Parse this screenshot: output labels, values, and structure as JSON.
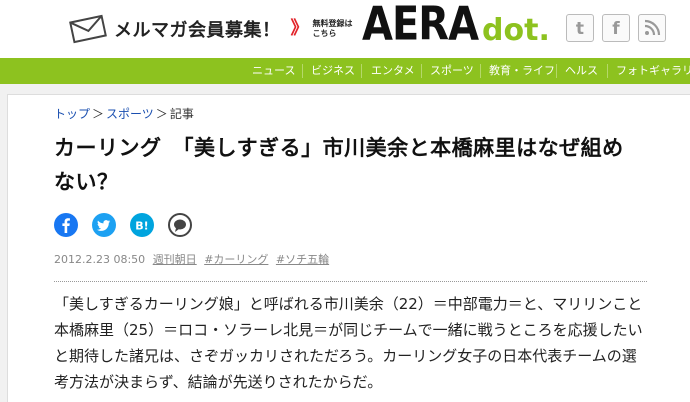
{
  "header": {
    "promo_text": "メルマガ会員募集！",
    "chevron": "》",
    "register_line1": "無料登録は",
    "register_line2": "こちら",
    "logo_aera": "AERA",
    "logo_dot": "dot."
  },
  "social_icons": [
    {
      "icon": "twitter-icon",
      "glyph": "t"
    },
    {
      "icon": "facebook-icon",
      "glyph": "f"
    },
    {
      "icon": "rss-icon",
      "glyph": "\\"
    }
  ],
  "nav": [
    "ニュース",
    "ビジネス",
    "エンタメ",
    "スポーツ",
    "教育・ライフ",
    "ヘルス",
    "フォトギャラリー"
  ],
  "breadcrumb": {
    "top": "トップ",
    "sep1": "＞",
    "sports": "スポーツ",
    "sep2": "＞",
    "current": "記事"
  },
  "article": {
    "title": "カーリング　「美しすぎる」市川美余と本橋麻里はなぜ組めない？",
    "date": "2012.2.23 08:50",
    "source": "週刊朝日",
    "tags": [
      "#カーリング",
      "#ソチ五輪"
    ],
    "body": "「美しすぎるカーリング娘」と呼ばれる市川美余（22）＝中部電力＝と、マリリンこと本橋麻里（25）＝ロコ・ソラーレ北見＝が同じチームで一緒に戦うところを応援したいと期待した諸兄は、さぞガッカリされただろう。カーリング女子の日本代表チームの選考方法が決まらず、結論が先送りされたからだ。"
  },
  "colors": {
    "brand_green": "#8dc21f",
    "facebook": "#1877f2",
    "twitter": "#1da1f2",
    "hatena": "#00a4de",
    "link_blue": "#1a4fb0"
  }
}
